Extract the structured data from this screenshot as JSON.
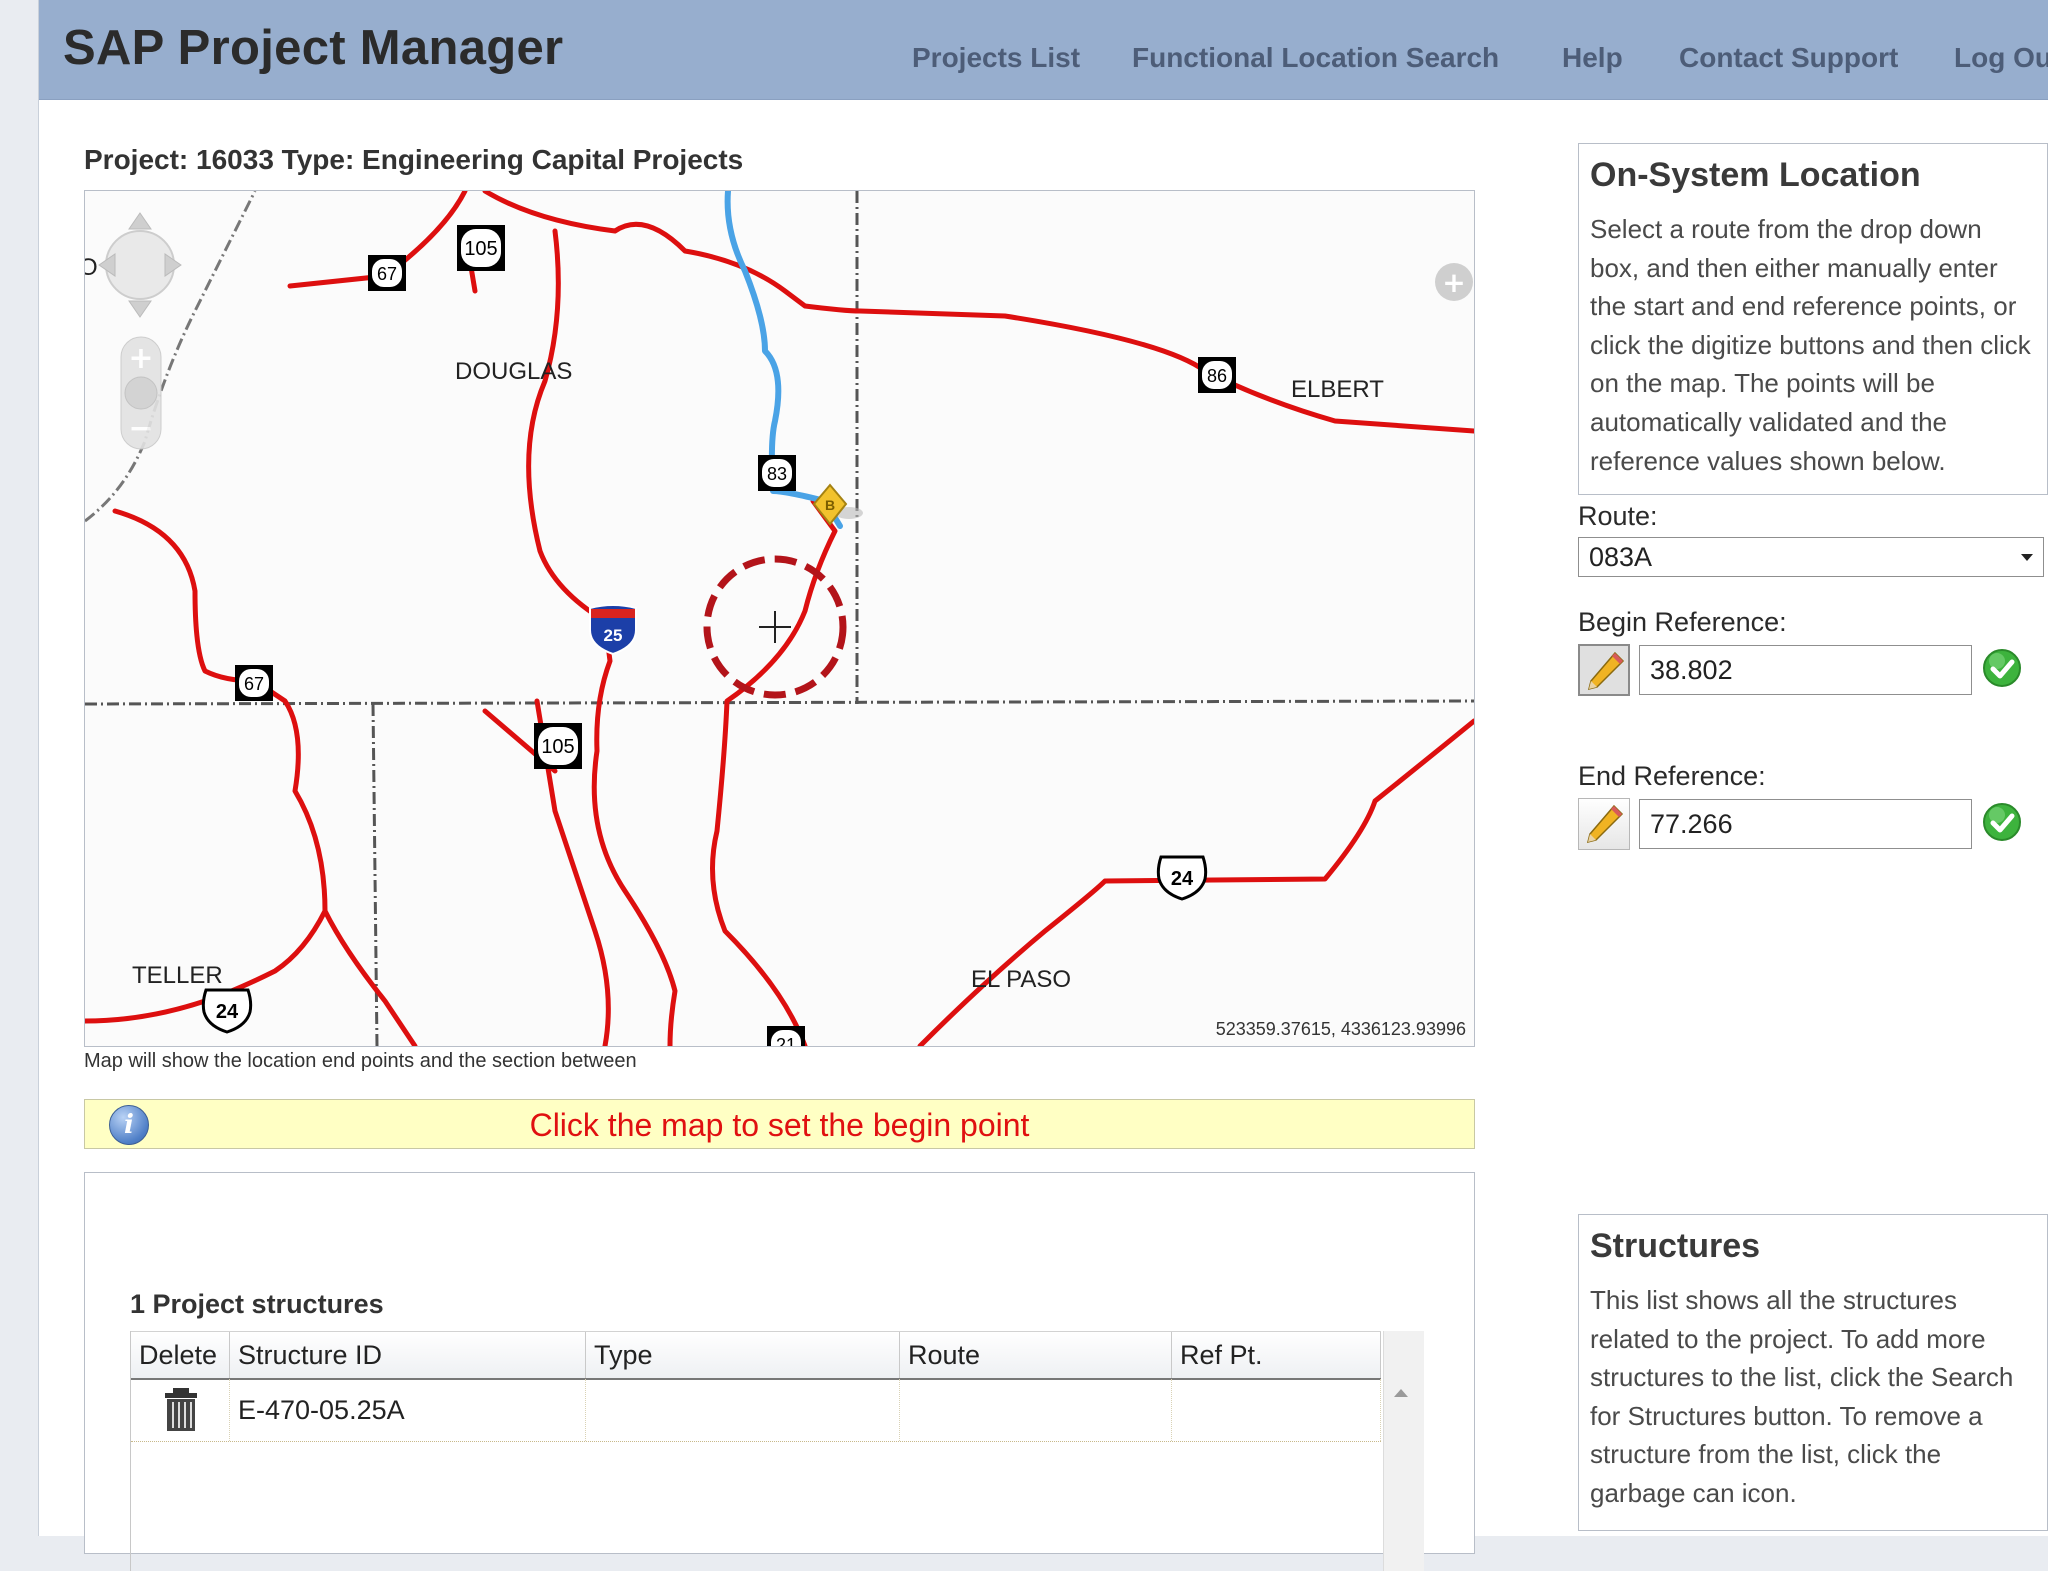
{
  "header": {
    "app_title": "SAP Project Manager",
    "nav": [
      {
        "label": "Projects List"
      },
      {
        "label": "Functional Location Search"
      },
      {
        "label": "Help"
      },
      {
        "label": "Contact Support"
      },
      {
        "label": "Log Ou"
      }
    ]
  },
  "project": {
    "summary": "Project: 16033 Type: Engineering Capital Projects"
  },
  "map": {
    "labels": {
      "douglas": "DOUGLAS",
      "elbert": "ELBERT",
      "teller": "TELLER",
      "el_paso": "EL PASO",
      "partial_left": "O"
    },
    "route_shields": {
      "state_67_top": "67",
      "state_105_top": "105",
      "state_86": "86",
      "state_83": "83",
      "state_67_left": "67",
      "state_105_mid": "105",
      "interstate_25": "25",
      "us_24_right": "24",
      "us_24_left": "24",
      "state_21": "21"
    },
    "begin_marker": "B",
    "coordinates": "523359.37615, 4336123.93996",
    "caption": "Map will show the location end points and the section between"
  },
  "info_bar": {
    "message": "Click the map to set the begin point"
  },
  "on_system": {
    "title": "On-System Location",
    "description": "Select a route from the drop down box, and then either manually enter the start and end reference points, or click the digitize buttons and then click on the map. The points will be automatically validated and the reference values shown below.",
    "route_label": "Route:",
    "route_value": "083A",
    "begin_label": "Begin Reference:",
    "begin_value": "38.802",
    "end_label": "End Reference:",
    "end_value": "77.266"
  },
  "structures_info": {
    "title": "Structures",
    "description": "This list shows all the structures related to the project. To add more structures to the list, click the Search for Structures button. To remove a structure from the list, click the garbage can icon."
  },
  "structures_table": {
    "count_label": "1 Project structures",
    "columns": [
      "Delete",
      "Structure ID",
      "Type",
      "Route",
      "Ref Pt."
    ],
    "rows": [
      {
        "structure_id": "E-470-05.25A",
        "type": "",
        "route": "",
        "ref_pt": ""
      }
    ]
  },
  "colors": {
    "header_bg": "#97aece",
    "road": "#dd0f0f",
    "selected_route": "#4aa3e6",
    "message": "#e01010",
    "info_bg": "#ffffc4"
  }
}
